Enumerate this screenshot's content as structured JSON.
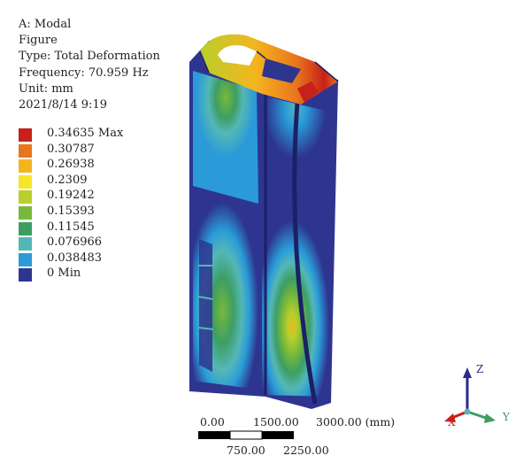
{
  "header": {
    "analysis": "A: Modal",
    "name": "Figure",
    "type": "Type: Total Deformation",
    "frequency": "Frequency: 70.959 Hz",
    "unit": "Unit: mm",
    "timestamp": "2021/8/14 9:19"
  },
  "legend": {
    "items": [
      {
        "label": "0.34635 Max",
        "color": "#c8201a"
      },
      {
        "label": "0.30787",
        "color": "#e8761e"
      },
      {
        "label": "0.26938",
        "color": "#f3b51f"
      },
      {
        "label": "0.2309",
        "color": "#f6e629"
      },
      {
        "label": "0.19242",
        "color": "#b9cf2c"
      },
      {
        "label": "0.15393",
        "color": "#79b93a"
      },
      {
        "label": "0.11545",
        "color": "#3d9e63"
      },
      {
        "label": "0.076966",
        "color": "#54b7b7"
      },
      {
        "label": "0.038483",
        "color": "#2a9bd8"
      },
      {
        "label": "0 Min",
        "color": "#2e3590"
      }
    ]
  },
  "scale_bar": {
    "label_0": "0.00",
    "label_1500": "1500.00",
    "label_3000": "3000.00 (mm)",
    "label_750": "750.00",
    "label_2250": "2250.00"
  },
  "triad": {
    "z": "Z",
    "y": "Y",
    "x": "X"
  },
  "colors": {
    "min": "#2e3590",
    "max": "#c8201a"
  },
  "icons": [
    "coordinate-triad-icon",
    "deformation-model-icon"
  ]
}
